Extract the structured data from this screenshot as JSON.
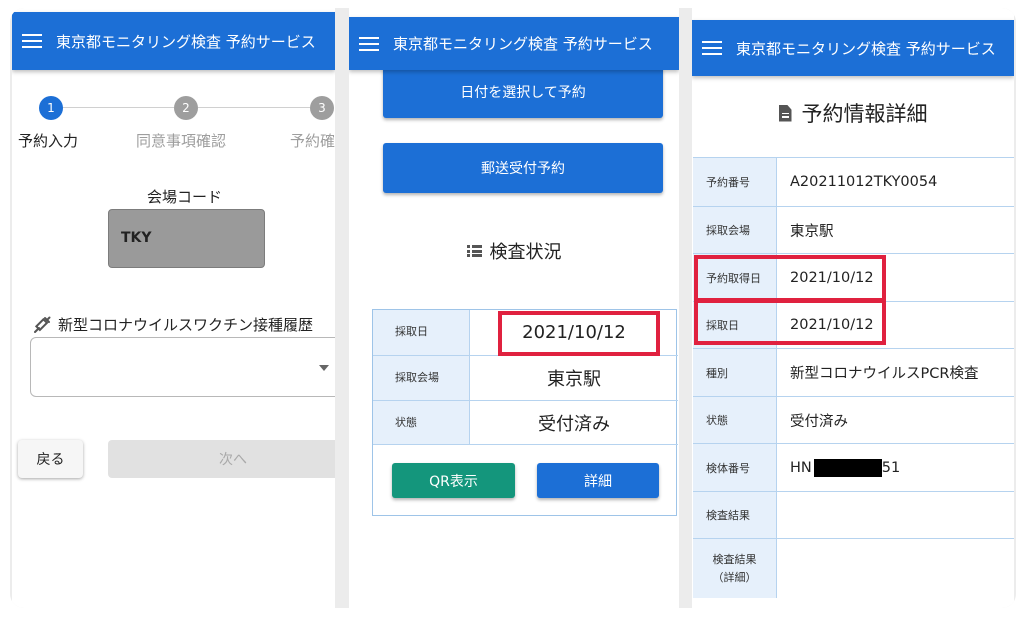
{
  "panel1": {
    "appbar_title": "東京都モニタリング検査 予約サービス",
    "steps": [
      {
        "number": "1",
        "label": "予約入力"
      },
      {
        "number": "2",
        "label": "同意事項確認"
      },
      {
        "number": "3",
        "label": "予約確"
      }
    ],
    "venue_code_label": "会場コード",
    "venue_code_value": "TKY",
    "vaccine_label": "新型コロナウイルスワクチン接種履歴",
    "vaccine_value": "",
    "back_label": "戻る",
    "next_label": "次へ"
  },
  "panel2": {
    "appbar_title": "東京都モニタリング検査 予約サービス",
    "date_reserve_label": "日付を選択して予約",
    "mail_reserve_label": "郵送受付予約",
    "status_heading": "検査状況",
    "status_rows": [
      {
        "key": "採取日",
        "value": "2021/10/12"
      },
      {
        "key": "採取会場",
        "value": "東京駅"
      },
      {
        "key": "状態",
        "value": "受付済み"
      }
    ],
    "qr_label": "QR表示",
    "detail_label": "詳細"
  },
  "panel3": {
    "appbar_title": "東京都モニタリング検査 予約サービス",
    "title": "予約情報詳細",
    "rows": [
      {
        "key": "予約番号",
        "value": "A20211012TKY0054"
      },
      {
        "key": "採取会場",
        "value": "東京駅"
      },
      {
        "key": "予約取得日",
        "value": "2021/10/12"
      },
      {
        "key": "採取日",
        "value": "2021/10/12"
      },
      {
        "key": "種別",
        "value": "新型コロナウイルスPCR検査"
      },
      {
        "key": "状態",
        "value": "受付済み"
      },
      {
        "key": "検体番号",
        "value_prefix": "HN",
        "value_suffix": "51"
      },
      {
        "key": "検査結果",
        "value": ""
      },
      {
        "key": "検査結果\n（詳細）",
        "value": ""
      }
    ]
  },
  "colors": {
    "appbar": "#1c6fd6",
    "primary_button": "#1c6fd6",
    "qr_button": "#14967c",
    "highlight": "#e0213f",
    "table_key_bg": "#e6f0fb"
  }
}
